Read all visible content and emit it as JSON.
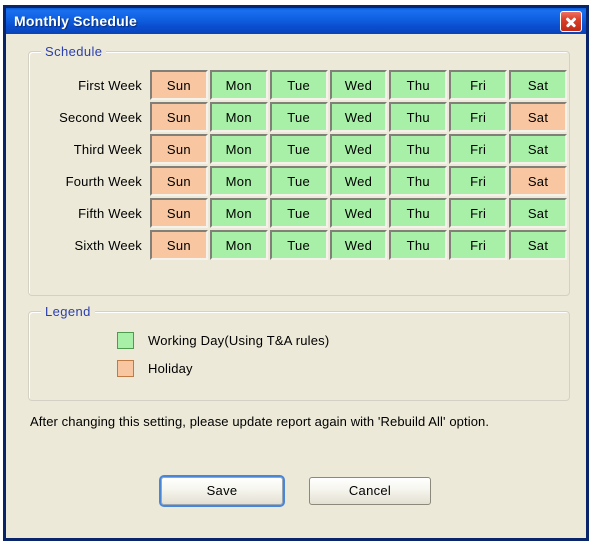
{
  "window": {
    "title": "Monthly Schedule",
    "close_icon": "close-icon"
  },
  "schedule": {
    "group_label": "Schedule",
    "day_headers": [
      "Sun",
      "Mon",
      "Tue",
      "Wed",
      "Thu",
      "Fri",
      "Sat"
    ],
    "rows": [
      {
        "label": "First Week",
        "days": [
          {
            "name": "Sun",
            "state": "holiday"
          },
          {
            "name": "Mon",
            "state": "working"
          },
          {
            "name": "Tue",
            "state": "working"
          },
          {
            "name": "Wed",
            "state": "working"
          },
          {
            "name": "Thu",
            "state": "working"
          },
          {
            "name": "Fri",
            "state": "working"
          },
          {
            "name": "Sat",
            "state": "working"
          }
        ]
      },
      {
        "label": "Second Week",
        "days": [
          {
            "name": "Sun",
            "state": "holiday"
          },
          {
            "name": "Mon",
            "state": "working"
          },
          {
            "name": "Tue",
            "state": "working"
          },
          {
            "name": "Wed",
            "state": "working"
          },
          {
            "name": "Thu",
            "state": "working"
          },
          {
            "name": "Fri",
            "state": "working"
          },
          {
            "name": "Sat",
            "state": "holiday"
          }
        ]
      },
      {
        "label": "Third Week",
        "days": [
          {
            "name": "Sun",
            "state": "holiday"
          },
          {
            "name": "Mon",
            "state": "working"
          },
          {
            "name": "Tue",
            "state": "working"
          },
          {
            "name": "Wed",
            "state": "working"
          },
          {
            "name": "Thu",
            "state": "working"
          },
          {
            "name": "Fri",
            "state": "working"
          },
          {
            "name": "Sat",
            "state": "working"
          }
        ]
      },
      {
        "label": "Fourth Week",
        "days": [
          {
            "name": "Sun",
            "state": "holiday"
          },
          {
            "name": "Mon",
            "state": "working"
          },
          {
            "name": "Tue",
            "state": "working"
          },
          {
            "name": "Wed",
            "state": "working"
          },
          {
            "name": "Thu",
            "state": "working"
          },
          {
            "name": "Fri",
            "state": "working"
          },
          {
            "name": "Sat",
            "state": "holiday"
          }
        ]
      },
      {
        "label": "Fifth Week",
        "days": [
          {
            "name": "Sun",
            "state": "holiday"
          },
          {
            "name": "Mon",
            "state": "working"
          },
          {
            "name": "Tue",
            "state": "working"
          },
          {
            "name": "Wed",
            "state": "working"
          },
          {
            "name": "Thu",
            "state": "working"
          },
          {
            "name": "Fri",
            "state": "working"
          },
          {
            "name": "Sat",
            "state": "working"
          }
        ]
      },
      {
        "label": "Sixth Week",
        "days": [
          {
            "name": "Sun",
            "state": "holiday"
          },
          {
            "name": "Mon",
            "state": "working"
          },
          {
            "name": "Tue",
            "state": "working"
          },
          {
            "name": "Wed",
            "state": "working"
          },
          {
            "name": "Thu",
            "state": "working"
          },
          {
            "name": "Fri",
            "state": "working"
          },
          {
            "name": "Sat",
            "state": "working"
          }
        ]
      }
    ]
  },
  "legend": {
    "group_label": "Legend",
    "items": [
      {
        "swatch": "working",
        "label": "Working Day(Using T&A rules)"
      },
      {
        "swatch": "holiday",
        "label": "Holiday"
      }
    ]
  },
  "note": {
    "text": "After changing this setting, please update report again with 'Rebuild All' option."
  },
  "buttons": {
    "save": "Save",
    "cancel": "Cancel"
  },
  "colors": {
    "working_day": "#a8f0a8",
    "holiday": "#f8c6a0",
    "titlebar": "#0a5ad6",
    "dialog_face": "#ece9d8",
    "group_label_text": "#2a3fb0",
    "close_button": "#d8402a"
  }
}
